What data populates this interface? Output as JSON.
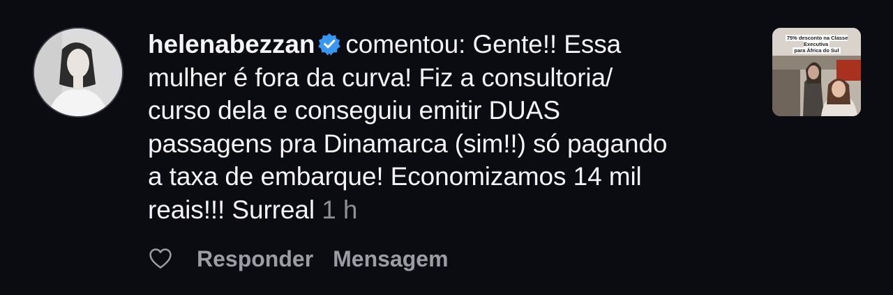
{
  "comment": {
    "username": "helenabezzan",
    "verb": "comentou:",
    "lines": [
      "Gente!! Essa",
      "mulher é fora da curva! Fiz a consultoria/",
      "curso dela e conseguiu emitir DUAS",
      "passagens pra Dinamarca (sim!!) só pagando",
      "a taxa de embarque! Economizamos 14 mil",
      "reais!!! Surreal"
    ],
    "time": "1 h"
  },
  "thumbnail": {
    "caption_line1": "75% desconto na Classe Executiva",
    "caption_line2": "para África do Sul"
  },
  "actions": {
    "reply_label": "Responder",
    "message_label": "Mensagem"
  },
  "icons": {
    "verified": "verified-badge-icon",
    "like": "heart-icon"
  },
  "colors": {
    "background": "#0b0b12",
    "text": "#f5f5f7",
    "muted": "#8e8e93",
    "verified": "#3897f0"
  }
}
